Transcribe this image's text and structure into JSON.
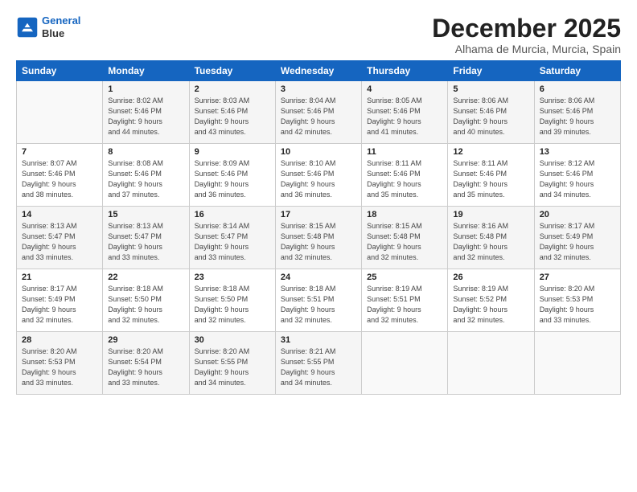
{
  "logo": {
    "line1": "General",
    "line2": "Blue"
  },
  "title": "December 2025",
  "subtitle": "Alhama de Murcia, Murcia, Spain",
  "days_header": [
    "Sunday",
    "Monday",
    "Tuesday",
    "Wednesday",
    "Thursday",
    "Friday",
    "Saturday"
  ],
  "weeks": [
    [
      {
        "day": "",
        "info": ""
      },
      {
        "day": "1",
        "info": "Sunrise: 8:02 AM\nSunset: 5:46 PM\nDaylight: 9 hours\nand 44 minutes."
      },
      {
        "day": "2",
        "info": "Sunrise: 8:03 AM\nSunset: 5:46 PM\nDaylight: 9 hours\nand 43 minutes."
      },
      {
        "day": "3",
        "info": "Sunrise: 8:04 AM\nSunset: 5:46 PM\nDaylight: 9 hours\nand 42 minutes."
      },
      {
        "day": "4",
        "info": "Sunrise: 8:05 AM\nSunset: 5:46 PM\nDaylight: 9 hours\nand 41 minutes."
      },
      {
        "day": "5",
        "info": "Sunrise: 8:06 AM\nSunset: 5:46 PM\nDaylight: 9 hours\nand 40 minutes."
      },
      {
        "day": "6",
        "info": "Sunrise: 8:06 AM\nSunset: 5:46 PM\nDaylight: 9 hours\nand 39 minutes."
      }
    ],
    [
      {
        "day": "7",
        "info": "Sunrise: 8:07 AM\nSunset: 5:46 PM\nDaylight: 9 hours\nand 38 minutes."
      },
      {
        "day": "8",
        "info": "Sunrise: 8:08 AM\nSunset: 5:46 PM\nDaylight: 9 hours\nand 37 minutes."
      },
      {
        "day": "9",
        "info": "Sunrise: 8:09 AM\nSunset: 5:46 PM\nDaylight: 9 hours\nand 36 minutes."
      },
      {
        "day": "10",
        "info": "Sunrise: 8:10 AM\nSunset: 5:46 PM\nDaylight: 9 hours\nand 36 minutes."
      },
      {
        "day": "11",
        "info": "Sunrise: 8:11 AM\nSunset: 5:46 PM\nDaylight: 9 hours\nand 35 minutes."
      },
      {
        "day": "12",
        "info": "Sunrise: 8:11 AM\nSunset: 5:46 PM\nDaylight: 9 hours\nand 35 minutes."
      },
      {
        "day": "13",
        "info": "Sunrise: 8:12 AM\nSunset: 5:46 PM\nDaylight: 9 hours\nand 34 minutes."
      }
    ],
    [
      {
        "day": "14",
        "info": "Sunrise: 8:13 AM\nSunset: 5:47 PM\nDaylight: 9 hours\nand 33 minutes."
      },
      {
        "day": "15",
        "info": "Sunrise: 8:13 AM\nSunset: 5:47 PM\nDaylight: 9 hours\nand 33 minutes."
      },
      {
        "day": "16",
        "info": "Sunrise: 8:14 AM\nSunset: 5:47 PM\nDaylight: 9 hours\nand 33 minutes."
      },
      {
        "day": "17",
        "info": "Sunrise: 8:15 AM\nSunset: 5:48 PM\nDaylight: 9 hours\nand 32 minutes."
      },
      {
        "day": "18",
        "info": "Sunrise: 8:15 AM\nSunset: 5:48 PM\nDaylight: 9 hours\nand 32 minutes."
      },
      {
        "day": "19",
        "info": "Sunrise: 8:16 AM\nSunset: 5:48 PM\nDaylight: 9 hours\nand 32 minutes."
      },
      {
        "day": "20",
        "info": "Sunrise: 8:17 AM\nSunset: 5:49 PM\nDaylight: 9 hours\nand 32 minutes."
      }
    ],
    [
      {
        "day": "21",
        "info": "Sunrise: 8:17 AM\nSunset: 5:49 PM\nDaylight: 9 hours\nand 32 minutes."
      },
      {
        "day": "22",
        "info": "Sunrise: 8:18 AM\nSunset: 5:50 PM\nDaylight: 9 hours\nand 32 minutes."
      },
      {
        "day": "23",
        "info": "Sunrise: 8:18 AM\nSunset: 5:50 PM\nDaylight: 9 hours\nand 32 minutes."
      },
      {
        "day": "24",
        "info": "Sunrise: 8:18 AM\nSunset: 5:51 PM\nDaylight: 9 hours\nand 32 minutes."
      },
      {
        "day": "25",
        "info": "Sunrise: 8:19 AM\nSunset: 5:51 PM\nDaylight: 9 hours\nand 32 minutes."
      },
      {
        "day": "26",
        "info": "Sunrise: 8:19 AM\nSunset: 5:52 PM\nDaylight: 9 hours\nand 32 minutes."
      },
      {
        "day": "27",
        "info": "Sunrise: 8:20 AM\nSunset: 5:53 PM\nDaylight: 9 hours\nand 33 minutes."
      }
    ],
    [
      {
        "day": "28",
        "info": "Sunrise: 8:20 AM\nSunset: 5:53 PM\nDaylight: 9 hours\nand 33 minutes."
      },
      {
        "day": "29",
        "info": "Sunrise: 8:20 AM\nSunset: 5:54 PM\nDaylight: 9 hours\nand 33 minutes."
      },
      {
        "day": "30",
        "info": "Sunrise: 8:20 AM\nSunset: 5:55 PM\nDaylight: 9 hours\nand 34 minutes."
      },
      {
        "day": "31",
        "info": "Sunrise: 8:21 AM\nSunset: 5:55 PM\nDaylight: 9 hours\nand 34 minutes."
      },
      {
        "day": "",
        "info": ""
      },
      {
        "day": "",
        "info": ""
      },
      {
        "day": "",
        "info": ""
      }
    ]
  ]
}
